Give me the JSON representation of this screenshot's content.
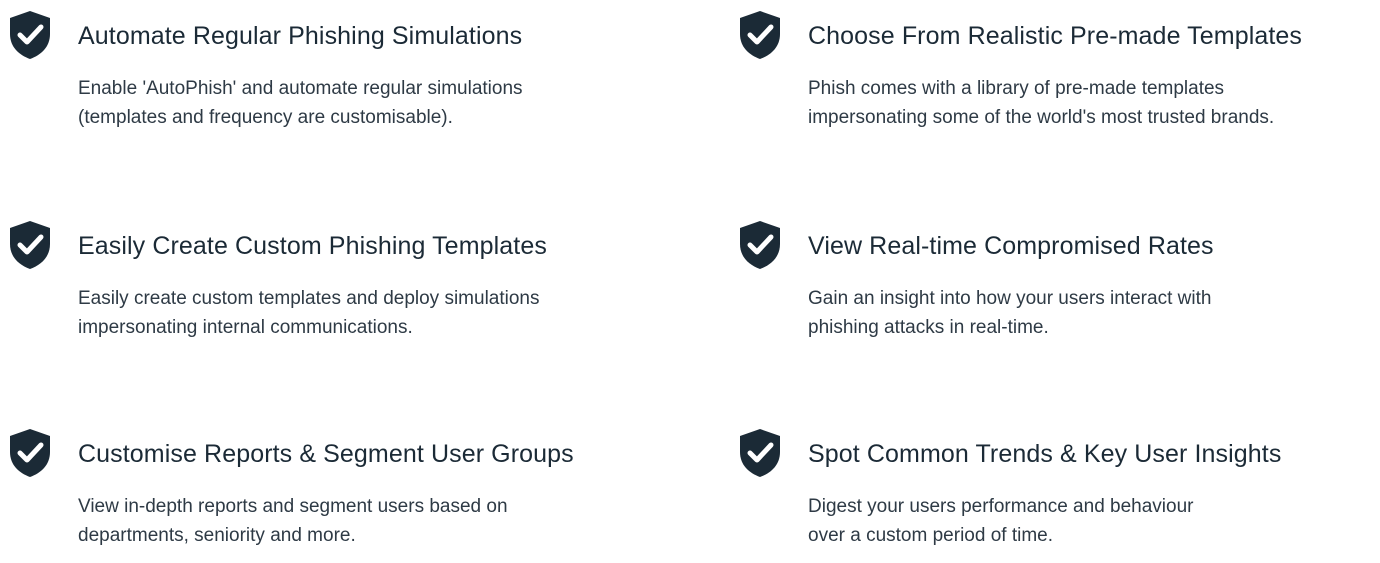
{
  "colors": {
    "icon": "#1b2a36",
    "title": "#1b2a36",
    "text": "#2e3a45",
    "background": "#ffffff"
  },
  "features": [
    {
      "icon": "shield-check-icon",
      "title": "Automate Regular Phishing Simulations",
      "description": "Enable 'AutoPhish' and automate regular simulations\n(templates and frequency are customisable)."
    },
    {
      "icon": "shield-check-icon",
      "title": "Choose From Realistic Pre-made Templates",
      "description": "Phish comes with a library of pre-made templates\nimpersonating some of the world's most trusted brands."
    },
    {
      "icon": "shield-check-icon",
      "title": "Easily Create Custom Phishing Templates",
      "description": "Easily create custom templates and deploy simulations\nimpersonating internal communications."
    },
    {
      "icon": "shield-check-icon",
      "title": "View Real-time Compromised Rates",
      "description": "Gain an insight into how your users interact with\nphishing attacks in real-time."
    },
    {
      "icon": "shield-check-icon",
      "title": "Customise Reports & Segment User Groups",
      "description": "View in-depth reports and segment users based on\ndepartments, seniority and more."
    },
    {
      "icon": "shield-check-icon",
      "title": "Spot Common Trends & Key User Insights",
      "description": "Digest your users performance and behaviour\nover a custom period of time."
    }
  ]
}
